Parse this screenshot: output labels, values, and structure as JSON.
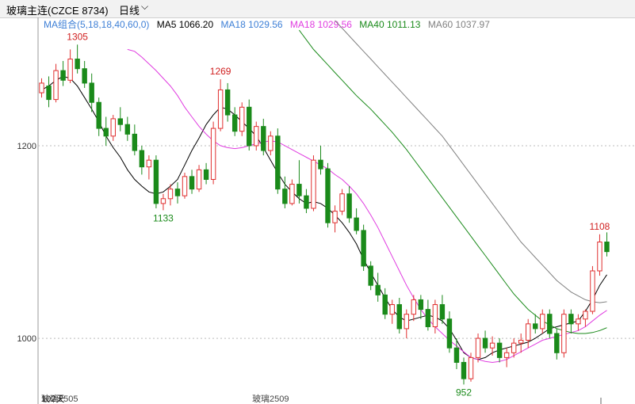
{
  "toolbar": {
    "title": "玻璃主连(CZCE 8734)",
    "period": "日线",
    "period_icon": "chevron-down-icon"
  },
  "legend": {
    "group": "MA组合(5,18,18,40,60,0)",
    "items": [
      {
        "label": "MA5 1066.20",
        "color": "#000000"
      },
      {
        "label": "MA18 1029.56",
        "color": "#3d7fd6"
      },
      {
        "label": "MA18 1029.56",
        "color": "#e03ce0"
      },
      {
        "label": "MA40 1011.13",
        "color": "#1a8a1a"
      },
      {
        "label": "MA60 1037.97",
        "color": "#808080"
      }
    ]
  },
  "chart_data": {
    "type": "candlestick",
    "y_ticks": [
      "1200",
      "1000"
    ],
    "annotations": [
      "1305",
      "1269",
      "1133",
      "952",
      "1108"
    ],
    "x_labels": [
      "102天",
      "玻璃2505",
      "玻璃2509"
    ],
    "ylim": [
      940,
      1325
    ],
    "colors": {
      "up": "#e03030",
      "down": "#1a8a1a"
    },
    "candles": [
      [
        1255,
        1270,
        1250,
        1265
      ],
      [
        1262,
        1272,
        1240,
        1248
      ],
      [
        1248,
        1285,
        1245,
        1278
      ],
      [
        1278,
        1288,
        1262,
        1268
      ],
      [
        1268,
        1300,
        1265,
        1290
      ],
      [
        1290,
        1305,
        1275,
        1280
      ],
      [
        1280,
        1288,
        1260,
        1265
      ],
      [
        1265,
        1275,
        1235,
        1245
      ],
      [
        1245,
        1250,
        1210,
        1218
      ],
      [
        1218,
        1230,
        1200,
        1210
      ],
      [
        1210,
        1232,
        1205,
        1228
      ],
      [
        1228,
        1240,
        1215,
        1222
      ],
      [
        1222,
        1230,
        1205,
        1212
      ],
      [
        1212,
        1222,
        1190,
        1195
      ],
      [
        1195,
        1200,
        1170,
        1178
      ],
      [
        1178,
        1190,
        1165,
        1185
      ],
      [
        1185,
        1190,
        1135,
        1140
      ],
      [
        1140,
        1150,
        1133,
        1145
      ],
      [
        1145,
        1160,
        1138,
        1155
      ],
      [
        1155,
        1162,
        1140,
        1148
      ],
      [
        1148,
        1172,
        1145,
        1168
      ],
      [
        1168,
        1175,
        1150,
        1155
      ],
      [
        1155,
        1180,
        1152,
        1175
      ],
      [
        1175,
        1182,
        1160,
        1165
      ],
      [
        1165,
        1225,
        1160,
        1218
      ],
      [
        1218,
        1269,
        1215,
        1258
      ],
      [
        1258,
        1265,
        1225,
        1232
      ],
      [
        1232,
        1240,
        1210,
        1215
      ],
      [
        1215,
        1245,
        1210,
        1240
      ],
      [
        1240,
        1248,
        1195,
        1200
      ],
      [
        1200,
        1225,
        1195,
        1220
      ],
      [
        1220,
        1228,
        1190,
        1195
      ],
      [
        1195,
        1215,
        1190,
        1210
      ],
      [
        1210,
        1218,
        1150,
        1155
      ],
      [
        1155,
        1168,
        1135,
        1140
      ],
      [
        1140,
        1165,
        1138,
        1160
      ],
      [
        1160,
        1185,
        1140,
        1148
      ],
      [
        1148,
        1155,
        1130,
        1135
      ],
      [
        1135,
        1190,
        1132,
        1185
      ],
      [
        1185,
        1200,
        1170,
        1176
      ],
      [
        1176,
        1182,
        1115,
        1120
      ],
      [
        1120,
        1138,
        1110,
        1132
      ],
      [
        1132,
        1155,
        1128,
        1150
      ],
      [
        1150,
        1158,
        1120,
        1125
      ],
      [
        1125,
        1135,
        1108,
        1112
      ],
      [
        1112,
        1118,
        1070,
        1075
      ],
      [
        1075,
        1080,
        1050,
        1055
      ],
      [
        1055,
        1068,
        1038,
        1045
      ],
      [
        1045,
        1052,
        1020,
        1025
      ],
      [
        1025,
        1040,
        1015,
        1035
      ],
      [
        1035,
        1042,
        1005,
        1010
      ],
      [
        1010,
        1030,
        1000,
        1025
      ],
      [
        1025,
        1045,
        1018,
        1040
      ],
      [
        1040,
        1045,
        1020,
        1030
      ],
      [
        1030,
        1040,
        1008,
        1012
      ],
      [
        1012,
        1040,
        1005,
        1035
      ],
      [
        1035,
        1045,
        1015,
        1020
      ],
      [
        1020,
        1028,
        985,
        990
      ],
      [
        990,
        1000,
        968,
        975
      ],
      [
        975,
        980,
        952,
        958
      ],
      [
        958,
        985,
        955,
        980
      ],
      [
        980,
        1005,
        975,
        1000
      ],
      [
        1000,
        1008,
        985,
        990
      ],
      [
        990,
        1002,
        982,
        995
      ],
      [
        995,
        1000,
        975,
        980
      ],
      [
        980,
        990,
        970,
        985
      ],
      [
        985,
        1000,
        980,
        995
      ],
      [
        995,
        1005,
        985,
        998
      ],
      [
        998,
        1020,
        990,
        1015
      ],
      [
        1015,
        1025,
        1005,
        1010
      ],
      [
        1010,
        1030,
        1005,
        1025
      ],
      [
        1025,
        1030,
        1000,
        1005
      ],
      [
        1005,
        1010,
        978,
        985
      ],
      [
        985,
        1030,
        980,
        1025
      ],
      [
        1025,
        1030,
        1005,
        1015
      ],
      [
        1015,
        1025,
        1008,
        1020
      ],
      [
        1020,
        1030,
        1012,
        1028
      ],
      [
        1028,
        1075,
        1025,
        1070
      ],
      [
        1070,
        1108,
        1065,
        1100
      ],
      [
        1100,
        1110,
        1085,
        1090
      ]
    ],
    "ma": [
      {
        "name": "MA5",
        "color": "#000000",
        "values": [
          1258,
          1262,
          1268,
          1272,
          1270,
          1262,
          1250,
          1238,
          1225,
          1210,
          1198,
          1188,
          1175,
          1165,
          1158,
          1152,
          1150,
          1152,
          1158,
          1165,
          1180,
          1195,
          1208,
          1222,
          1232,
          1240,
          1238,
          1232,
          1225,
          1218,
          1210,
          1198,
          1185,
          1172,
          1160,
          1152,
          1145,
          1140,
          1142,
          1140,
          1135,
          1128,
          1120,
          1110,
          1098,
          1082,
          1068,
          1055,
          1042,
          1030,
          1022,
          1018,
          1020,
          1022,
          1024,
          1022,
          1018,
          1010,
          998,
          985,
          980,
          978,
          980,
          985,
          988,
          990,
          992,
          994,
          996,
          1000,
          1005,
          1010,
          1012,
          1014,
          1016,
          1018,
          1028,
          1040,
          1055,
          1066
        ]
      },
      {
        "name": "MA18",
        "color": "#e03ce0",
        "values": [
          1300,
          1298,
          1292,
          1285,
          1278,
          1270,
          1262,
          1252,
          1240,
          1230,
          1220,
          1212,
          1205,
          1200,
          1198,
          1197,
          1198,
          1200,
          1202,
          1204,
          1205,
          1204,
          1200,
          1196,
          1192,
          1188,
          1184,
          1180,
          1176,
          1170,
          1165,
          1158,
          1150,
          1140,
          1128,
          1115,
          1100,
          1085,
          1070,
          1055,
          1042,
          1030,
          1020,
          1012,
          1005,
          998,
          992,
          986,
          980,
          978,
          976,
          975,
          976,
          978,
          982,
          986,
          990,
          994,
          998,
          1000,
          1002,
          1004,
          1006,
          1008,
          1012,
          1018,
          1024,
          1029
        ]
      },
      {
        "name": "MA40",
        "color": "#1a8a1a",
        "values": [
          1320,
          1310,
          1300,
          1292,
          1284,
          1276,
          1268,
          1260,
          1252,
          1245,
          1238,
          1230,
          1222,
          1214,
          1205,
          1196,
          1186,
          1176,
          1166,
          1156,
          1146,
          1136,
          1126,
          1116,
          1106,
          1096,
          1086,
          1076,
          1066,
          1056,
          1046,
          1038,
          1030,
          1024,
          1018,
          1014,
          1010,
          1008,
          1006,
          1005,
          1005,
          1006,
          1008,
          1011
        ]
      },
      {
        "name": "MA60",
        "color": "#808080",
        "values": [
          1330,
          1322,
          1314,
          1306,
          1298,
          1290,
          1282,
          1274,
          1266,
          1258,
          1250,
          1242,
          1234,
          1226,
          1218,
          1210,
          1200,
          1190,
          1180,
          1170,
          1160,
          1150,
          1140,
          1130,
          1120,
          1110,
          1100,
          1092,
          1084,
          1076,
          1068,
          1060,
          1054,
          1048,
          1044,
          1040,
          1038,
          1037,
          1038
        ]
      }
    ]
  }
}
